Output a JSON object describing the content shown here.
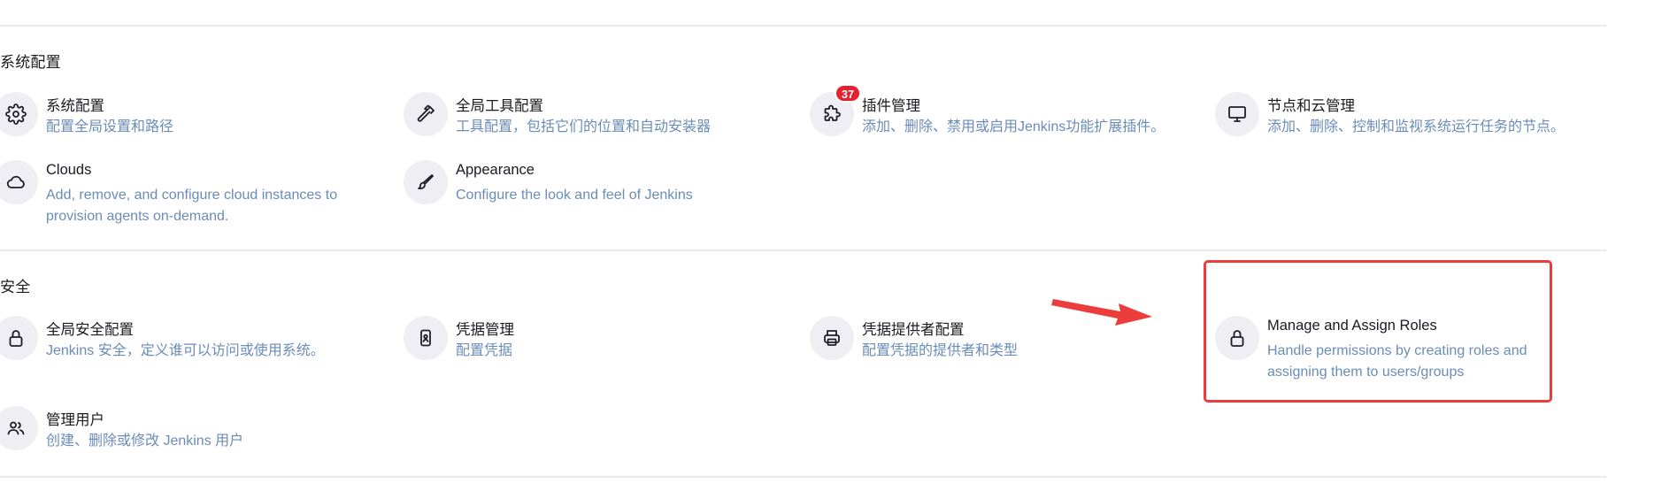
{
  "sections": [
    {
      "title": "系统配置"
    },
    {
      "title": "安全"
    }
  ],
  "items": {
    "system_config": {
      "title": "系统配置",
      "desc": "配置全局设置和路径",
      "icon": "gear-icon"
    },
    "global_tools": {
      "title": "全局工具配置",
      "desc": "工具配置，包括它们的位置和自动安装器",
      "icon": "hammer-icon"
    },
    "plugins": {
      "title": "插件管理",
      "desc": "添加、删除、禁用或启用Jenkins功能扩展插件。",
      "icon": "puzzle-icon",
      "badge": "37"
    },
    "nodes": {
      "title": "节点和云管理",
      "desc": "添加、删除、控制和监视系统运行任务的节点。",
      "icon": "monitor-icon"
    },
    "clouds": {
      "title": "Clouds",
      "desc_line1": "Add, remove, and configure cloud instances to",
      "desc_line2": "provision agents on-demand.",
      "icon": "cloud-icon"
    },
    "appearance": {
      "title": "Appearance",
      "desc": "Configure the look and feel of Jenkins",
      "icon": "brush-icon"
    },
    "global_security": {
      "title": "全局安全配置",
      "desc": "Jenkins 安全，定义谁可以访问或使用系统。",
      "icon": "lock-icon"
    },
    "credentials": {
      "title": "凭据管理",
      "desc": "配置凭据",
      "icon": "id-card-icon"
    },
    "credential_providers": {
      "title": "凭据提供者配置",
      "desc": "配置凭据的提供者和类型",
      "icon": "printer-icon"
    },
    "roles": {
      "title": "Manage and Assign Roles",
      "desc_line1": "Handle permissions by creating roles and",
      "desc_line2": "assigning them to users/groups",
      "icon": "lock-icon"
    },
    "users": {
      "title": "管理用户",
      "desc": "创建、删除或修改 Jenkins 用户",
      "icon": "users-icon"
    }
  },
  "annotations": {
    "highlight_color": "#ec3d3d",
    "arrow_color": "#ec3d3d"
  },
  "colors": {
    "description_text": "#6a8cb8",
    "title_text": "#1a1a22",
    "icon_background": "#eeeef3",
    "badge": "#e6212f"
  }
}
